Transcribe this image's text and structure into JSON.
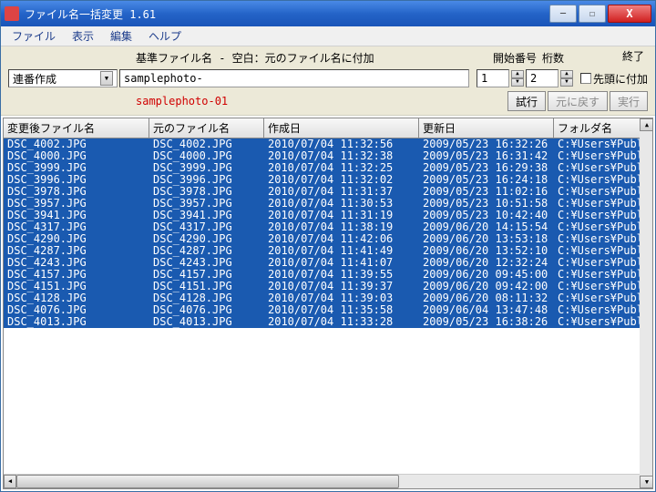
{
  "window": {
    "title": "ファイル名一括変更 1.61"
  },
  "menu": {
    "file": "ファイル",
    "view": "表示",
    "edit": "編集",
    "help": "ヘルプ"
  },
  "toolbar": {
    "base_label": "基準ファイル名 - 空白：元のファイル名に付加",
    "start_num_label": "開始番号",
    "digits_label": "桁数",
    "exit_label": "終了",
    "mode_value": "連番作成",
    "basefile_value": "samplephoto-",
    "start_num_value": "1",
    "digits_value": "2",
    "prefix_checkbox": "先頭に付加",
    "preview": "samplephoto-01",
    "btn_try": "試行",
    "btn_undo": "元に戻す",
    "btn_exec": "実行"
  },
  "columns": {
    "c0": "変更後ファイル名",
    "c1": "元のファイル名",
    "c2": "作成日",
    "c3": "更新日",
    "c4": "フォルダ名"
  },
  "rows": [
    {
      "new": "DSC_4002.JPG",
      "old": "DSC_4002.JPG",
      "created": "2010/07/04 11:32:56",
      "modified": "2009/05/23 16:32:26",
      "folder": "C:¥Users¥Public"
    },
    {
      "new": "DSC_4000.JPG",
      "old": "DSC_4000.JPG",
      "created": "2010/07/04 11:32:38",
      "modified": "2009/05/23 16:31:42",
      "folder": "C:¥Users¥Public"
    },
    {
      "new": "DSC_3999.JPG",
      "old": "DSC_3999.JPG",
      "created": "2010/07/04 11:32:25",
      "modified": "2009/05/23 16:29:38",
      "folder": "C:¥Users¥Public"
    },
    {
      "new": "DSC_3996.JPG",
      "old": "DSC_3996.JPG",
      "created": "2010/07/04 11:32:02",
      "modified": "2009/05/23 16:24:18",
      "folder": "C:¥Users¥Public"
    },
    {
      "new": "DSC_3978.JPG",
      "old": "DSC_3978.JPG",
      "created": "2010/07/04 11:31:37",
      "modified": "2009/05/23 11:02:16",
      "folder": "C:¥Users¥Public"
    },
    {
      "new": "DSC_3957.JPG",
      "old": "DSC_3957.JPG",
      "created": "2010/07/04 11:30:53",
      "modified": "2009/05/23 10:51:58",
      "folder": "C:¥Users¥Public"
    },
    {
      "new": "DSC_3941.JPG",
      "old": "DSC_3941.JPG",
      "created": "2010/07/04 11:31:19",
      "modified": "2009/05/23 10:42:40",
      "folder": "C:¥Users¥Public"
    },
    {
      "new": "DSC_4317.JPG",
      "old": "DSC_4317.JPG",
      "created": "2010/07/04 11:38:19",
      "modified": "2009/06/20 14:15:54",
      "folder": "C:¥Users¥Public"
    },
    {
      "new": "DSC_4290.JPG",
      "old": "DSC_4290.JPG",
      "created": "2010/07/04 11:42:06",
      "modified": "2009/06/20 13:53:18",
      "folder": "C:¥Users¥Public"
    },
    {
      "new": "DSC_4287.JPG",
      "old": "DSC_4287.JPG",
      "created": "2010/07/04 11:41:49",
      "modified": "2009/06/20 13:52:10",
      "folder": "C:¥Users¥Public"
    },
    {
      "new": "DSC_4243.JPG",
      "old": "DSC_4243.JPG",
      "created": "2010/07/04 11:41:07",
      "modified": "2009/06/20 12:32:24",
      "folder": "C:¥Users¥Public"
    },
    {
      "new": "DSC_4157.JPG",
      "old": "DSC_4157.JPG",
      "created": "2010/07/04 11:39:55",
      "modified": "2009/06/20 09:45:00",
      "folder": "C:¥Users¥Public"
    },
    {
      "new": "DSC_4151.JPG",
      "old": "DSC_4151.JPG",
      "created": "2010/07/04 11:39:37",
      "modified": "2009/06/20 09:42:00",
      "folder": "C:¥Users¥Public"
    },
    {
      "new": "DSC_4128.JPG",
      "old": "DSC_4128.JPG",
      "created": "2010/07/04 11:39:03",
      "modified": "2009/06/20 08:11:32",
      "folder": "C:¥Users¥Public"
    },
    {
      "new": "DSC_4076.JPG",
      "old": "DSC_4076.JPG",
      "created": "2010/07/04 11:35:58",
      "modified": "2009/06/04 13:47:48",
      "folder": "C:¥Users¥Public"
    },
    {
      "new": "DSC_4013.JPG",
      "old": "DSC_4013.JPG",
      "created": "2010/07/04 11:33:28",
      "modified": "2009/05/23 16:38:26",
      "folder": "C:¥Users¥Public"
    }
  ]
}
